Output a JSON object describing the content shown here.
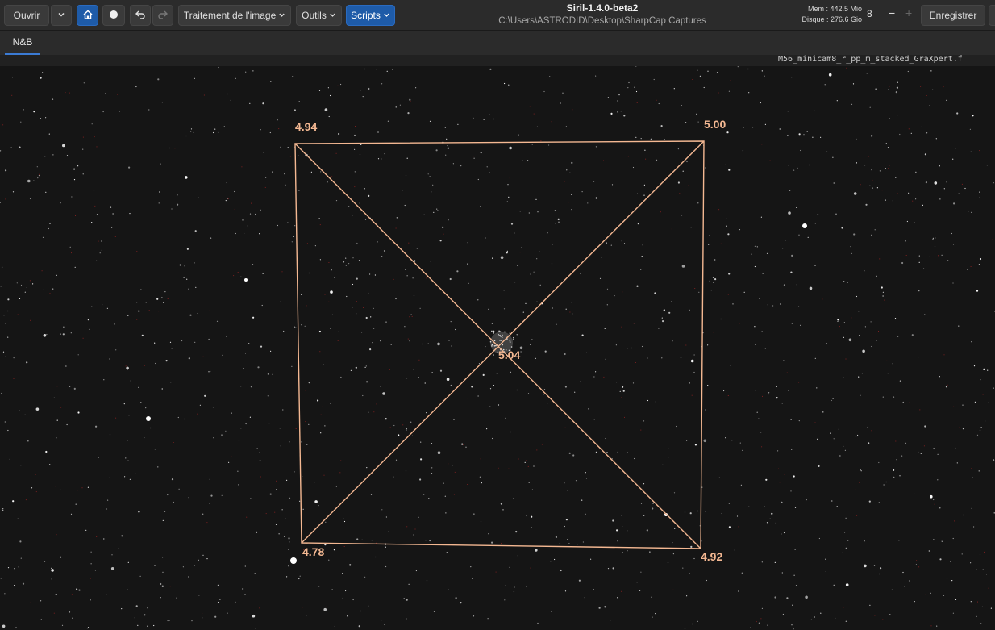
{
  "toolbar": {
    "open_label": "Ouvrir",
    "image_processing_label": "Traitement de l'image",
    "tools_label": "Outils",
    "scripts_label": "Scripts",
    "save_label": "Enregistrer"
  },
  "window": {
    "title": "Siril-1.4.0-beta2",
    "path": "C:\\Users\\ASTRODID\\Desktop\\SharpCap Captures"
  },
  "status": {
    "memory": "Mem : 442.5 Mio",
    "disk": "Disque : 276.6 Gio",
    "threads": "8"
  },
  "tabs": {
    "active": "N&B"
  },
  "image": {
    "filename": "M56_minicam8_r_pp_m_stacked_GraXpert.f"
  },
  "analysis": {
    "corner_top_left": "4.94",
    "corner_top_right": "5.00",
    "center": "5.04",
    "corner_bottom_left": "4.78",
    "corner_bottom_right": "4.92"
  },
  "colors": {
    "overlay": "#f4b892",
    "accent": "#1e5ba8",
    "background": "#2b2b2b"
  }
}
